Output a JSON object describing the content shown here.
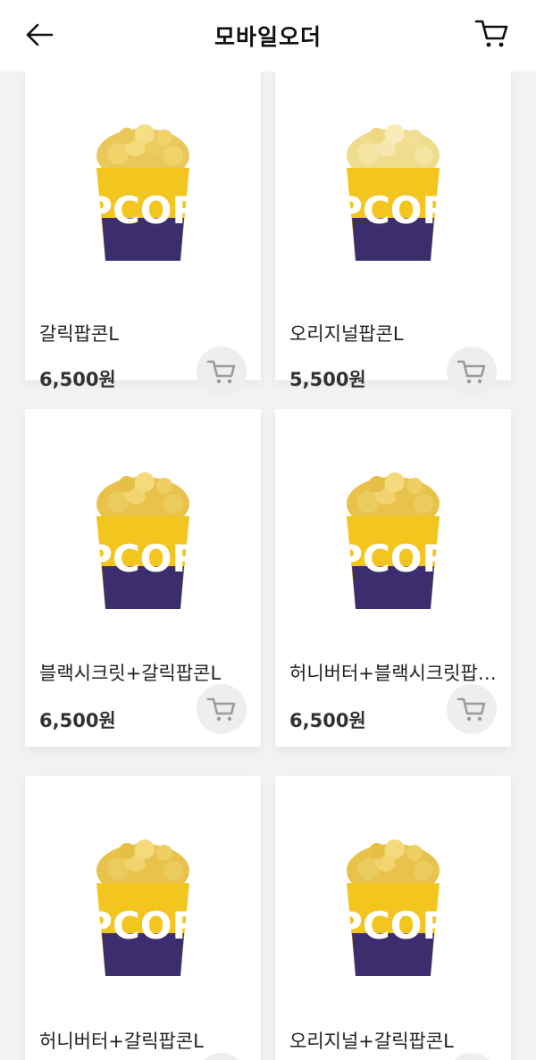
{
  "header": {
    "title": "모바일오더",
    "back_icon": "arrow-left-icon",
    "cart_icon": "cart-icon"
  },
  "colors": {
    "cup_yellow": "#f3c51f",
    "cup_purple": "#3b2d6e",
    "popcorn": "#e8c85a",
    "add_button_bg": "#eeeeee",
    "cart_icon_gray": "#9a9a9a"
  },
  "products": [
    {
      "name": "갈릭팝콘L",
      "price": "6,500원",
      "cup_text": "PCOR"
    },
    {
      "name": "오리지널팝콘L",
      "price": "5,500원",
      "cup_text": "PCOR"
    },
    {
      "name": "블랙시크릿+갈릭팝콘L",
      "price": "6,500원",
      "cup_text": "PCOR"
    },
    {
      "name": "허니버터+블랙시크릿팝콘L",
      "price": "6,500원",
      "cup_text": "PCOR"
    },
    {
      "name": "허니버터+갈릭팝콘L",
      "price": "",
      "cup_text": "PCOR"
    },
    {
      "name": "오리지널+갈릭팝콘L",
      "price": "",
      "cup_text": "PCOR"
    }
  ]
}
